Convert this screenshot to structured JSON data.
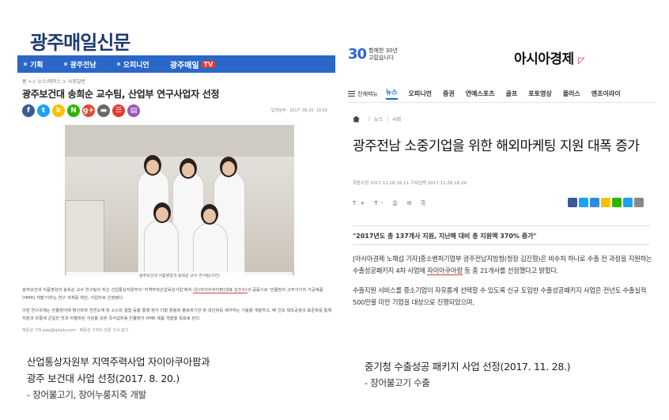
{
  "left_article": {
    "logo": "광주매일신문",
    "nav": [
      "기획",
      "광주전남",
      "오피니언"
    ],
    "tv_label": "광주매일",
    "tv_badge": "TV",
    "breadcrumb": "홈 >> 뉴스/레저스 > 사회일반",
    "title": "광주보건대 송희순 교수팀, 산업부 연구사업자 선정",
    "date": "입력날짜 : 2017. 08.20. 19:52",
    "share_icons": [
      "f",
      "t",
      "k",
      "N",
      "g+",
      "▬",
      "☰",
      "▤"
    ],
    "share_colors": [
      "#3b5998",
      "#1da1f2",
      "#f9c000",
      "#2db400",
      "#dd4b39",
      "#6a6a6a",
      "#e8382f",
      "#9b59b6"
    ],
    "photo_caption": "광주보건대 식품영양과 송희순 교수 연구팀(사진)",
    "paragraph1_before": "광주보건대 식품영양과 송희순 교수 연구팀이 최근 산업통상자원부의 '지역주력산업육성사업'에서 ",
    "paragraph1_highlight": "(유)자이아쿠아팜(대표 김진수)",
    "paragraph1_after": "과 공동으로 '민물장어 고부가가치 가공제품(HMR) 개발'이라는 연구 과제를 제안, 사업자로 선정됐다.",
    "paragraph2": "이번 연구과제는 민물장어에 항산화력 천연소재 및 소스와 결합 등을 통해 장어 다발 활용화 불로화기반 및 과산화를 제어하는 기술을 개발하고, 뼈 건조 제조공정의 표준화를 통해 저장과 유통에 균일한 맛과 차별화된 식감을 갖춘 즉석섭취용 민물장어 HMR 제품 개발을 목표로 한다.",
    "footer": "박준성 기자 pes@kjdaily.com · 박준성 기자의 다른 기사 보기"
  },
  "right_article": {
    "anniversary_number": "30",
    "anniversary_text_1": "함께한 30년",
    "anniversary_text_2": "고맙습니다",
    "logo": "아시아경제",
    "menu_label": "전체메뉴",
    "tabs": [
      "뉴스",
      "오피니언",
      "증권",
      "연예스포츠",
      "골프",
      "포토영상",
      "플러스",
      "엔조이라이"
    ],
    "breadcrumb": [
      "뉴스",
      "사회"
    ],
    "title": "광주전남 소중기업을 위한 해외마케팅 지원 대폭 증가",
    "date": "최종수정 2017.11.28 16:11   기사입력 2017.11.28 16:29",
    "tools": "T+ T- ⎙ ✉ ⎘",
    "share_colors": [
      "#3b5998",
      "#1da1f2",
      "#2c8adf",
      "#f9c000",
      "#2db400",
      "#1da1f2",
      "#888888"
    ],
    "summary": "\"2017년도 총 137개사 지원, 지난해 대비 총 지원액 370% 증가\"",
    "paragraph1_before": "[아시아경제 노해섭 기자]중소벤처기업부 광주전남지방청(청장 김진형)은 비수처 하나로 수출 전 과정을 지원하는 수출성공패키지 4차 사업에 ",
    "paragraph1_highlight": "자이아쿠아팜",
    "paragraph1_after": " 등 총 21개사를 선정했다고 밝혔다.",
    "paragraph2": "수출지원 서비스를 중소기업이 자유롭게 선택할 수 있도록 신규 도입한 수출성공패키지 사업은 전년도 수출실적 500만불 미만 기업을 대상으로 진행되었으며,"
  },
  "captions": {
    "left_line1": "산업통상자원부 지역주력사업 자이아쿠아팜과",
    "left_line2": "광주 보건대 사업 선정(2017. 8. 20.)",
    "left_line3": "- 장어불고기, 장어누룽지죽 개발",
    "right_line1": "중기청 수출성공 패키지 사업 선정(2017. 11. 28.)",
    "right_line2": "- 장어불고기 수출"
  }
}
